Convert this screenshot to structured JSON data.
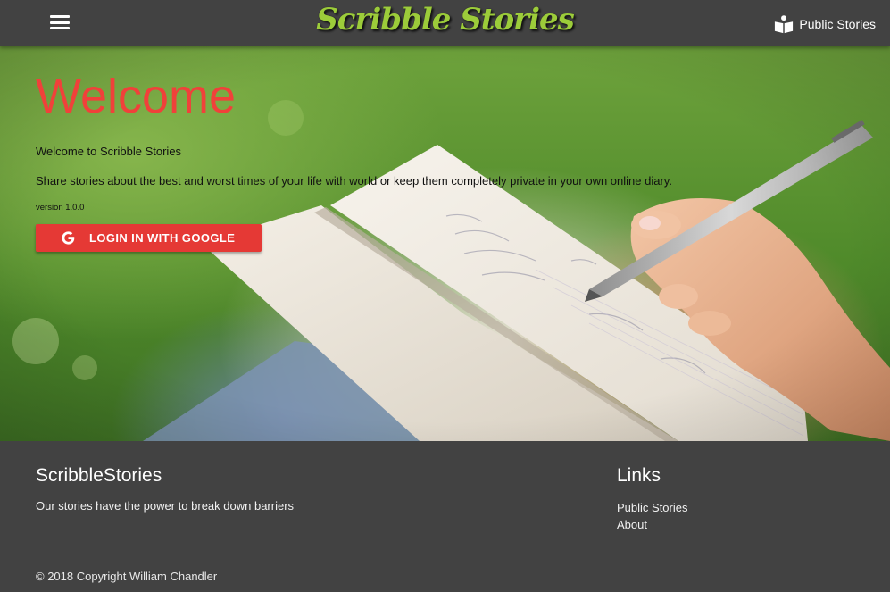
{
  "nav": {
    "brand": "Scribble Stories",
    "public_stories": "Public Stories",
    "menu_icon": "hamburger-menu-icon",
    "public_icon": "book-reader-icon"
  },
  "hero": {
    "title": "Welcome",
    "subtitle": "Welcome to Scribble Stories",
    "description": "Share stories about the best and worst times of your life with world or keep them completely private in your own online diary.",
    "version": "version 1.0.0",
    "login_button": "LOGIN IN WITH GOOGLE",
    "login_icon": "google-icon",
    "background_image": "hand-writing-in-notebook-on-grass"
  },
  "footer": {
    "about_title": "ScribbleStories",
    "about_text": "Our stories have the power to break down barriers",
    "links_title": "Links",
    "links": [
      "Public Stories",
      "About"
    ],
    "copyright": "© 2018 Copyright William Chandler"
  },
  "colors": {
    "navbar": "#424242",
    "brand": "#9ccc3a",
    "title_red": "#f0413a",
    "button_red": "#e53935",
    "footer": "#424242"
  }
}
